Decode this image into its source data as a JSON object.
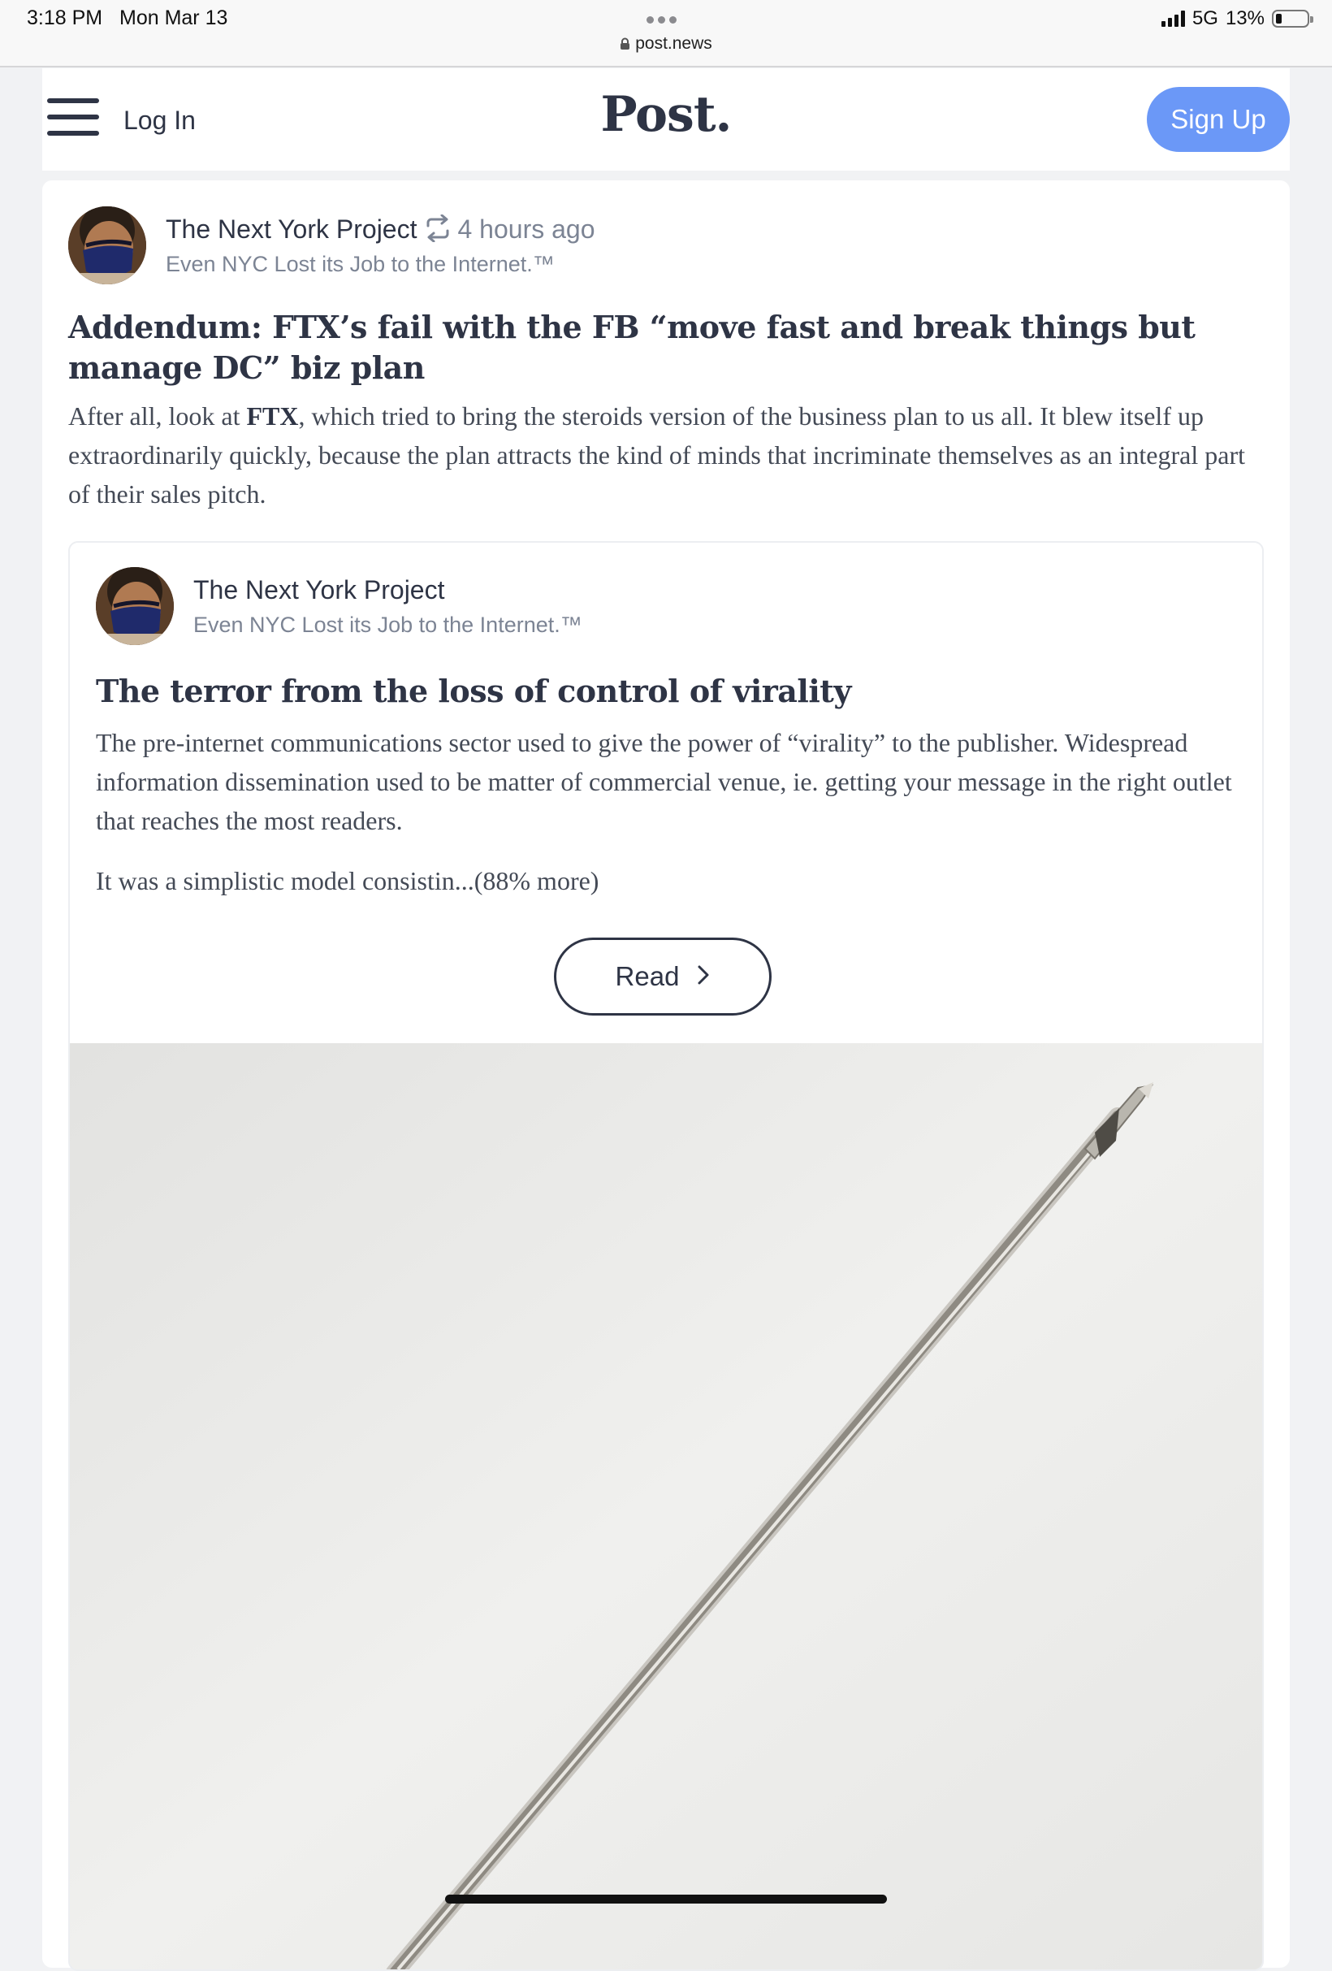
{
  "status_bar": {
    "time": "3:18 PM",
    "date": "Mon Mar 13",
    "url": "post.news",
    "network": "5G",
    "battery": "13%",
    "battery_level": 0.13
  },
  "header": {
    "menu_icon": "hamburger-menu-icon",
    "login_label": "Log In",
    "logo": "Post.",
    "signup_label": "Sign Up",
    "accent_color": "#6b98f7"
  },
  "post": {
    "author": "The Next York Project",
    "repost_icon": "repost-icon",
    "time_ago": "4 hours ago",
    "tagline": "Even NYC Lost its Job to the Internet.™",
    "title": "Addendum: FTX’s fail with the FB “move fast and break things but manage DC” biz plan",
    "body_before": "After all, look at ",
    "body_bold": "FTX",
    "body_after": ", which tried to bring the steroids version of the business plan to us all. It blew itself up extraordinarily quickly, because the plan attracts the kind of minds that incriminate themselves as an integral part of their sales pitch."
  },
  "quoted_post": {
    "author": "The Next York Project",
    "tagline": "Even NYC Lost its Job to the Internet.™",
    "title": "The terror from the loss of control of virality",
    "paragraph1": "The pre-internet communications sector used to give the power of “virality” to the publisher. Widespread information dissemination used to be matter of commercial venue, ie. getting your message in the right outlet that reaches the most readers.",
    "paragraph2": "It was a simplistic model consistin...(88% more)",
    "read_label": "Read",
    "read_icon": "chevron-right-icon",
    "image_subject": "needle-image"
  }
}
